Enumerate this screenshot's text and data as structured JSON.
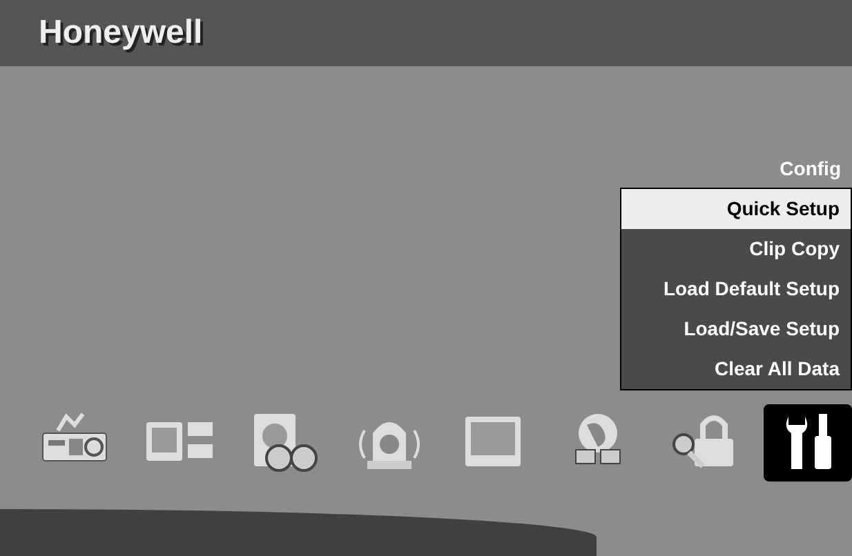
{
  "header": {
    "logo": "Honeywell"
  },
  "menu": {
    "title": "Config",
    "items": [
      {
        "label": "Quick Setup",
        "selected": true
      },
      {
        "label": "Clip Copy",
        "selected": false
      },
      {
        "label": "Load Default Setup",
        "selected": false
      },
      {
        "label": "Load/Save Setup",
        "selected": false
      },
      {
        "label": "Clear All Data",
        "selected": false
      }
    ]
  },
  "toolbar": [
    {
      "kind": "recorder",
      "selected": false
    },
    {
      "kind": "cameras",
      "selected": false
    },
    {
      "kind": "disk",
      "selected": false
    },
    {
      "kind": "alarm",
      "selected": false
    },
    {
      "kind": "monitor",
      "selected": false
    },
    {
      "kind": "network",
      "selected": false
    },
    {
      "kind": "lock",
      "selected": false
    },
    {
      "kind": "tools",
      "selected": true
    }
  ]
}
